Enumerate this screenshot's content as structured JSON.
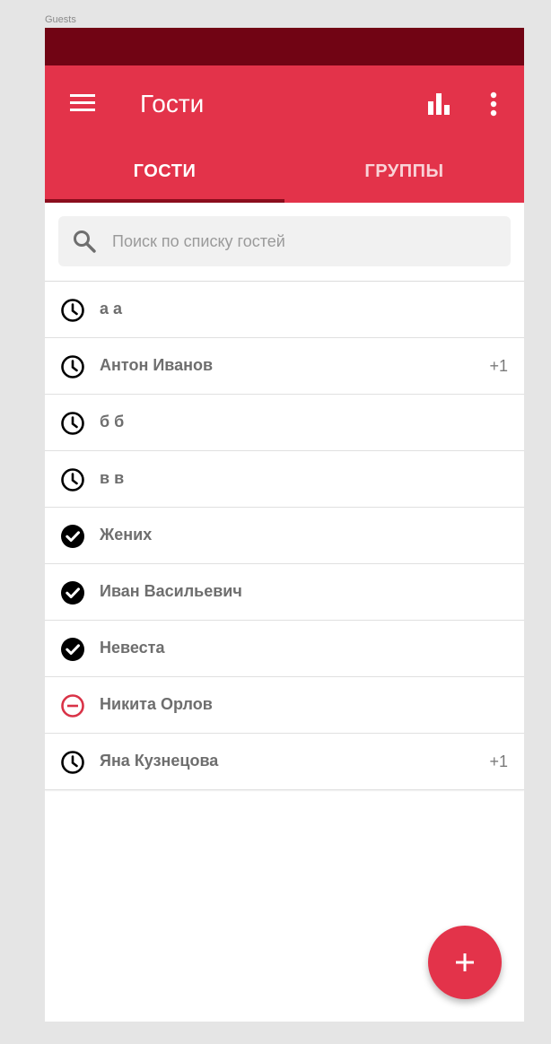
{
  "frame": {
    "label": "Guests"
  },
  "colors": {
    "status_bar": "#710414",
    "primary": "#e3334a",
    "tab_indicator": "#8b0d1d",
    "declined": "#d93347",
    "text": "#6e6e6e"
  },
  "app_bar": {
    "title": "Гости",
    "menu_icon": "hamburger-menu-icon",
    "stats_icon": "bar-chart-icon",
    "more_icon": "more-vert-icon"
  },
  "tabs": [
    {
      "label": "ГОСТИ",
      "active": true
    },
    {
      "label": "ГРУППЫ",
      "active": false
    }
  ],
  "search": {
    "placeholder": "Поиск по списку гостей",
    "value": "",
    "icon": "search-icon"
  },
  "guests": [
    {
      "name": "а а",
      "status": "pending",
      "plus": ""
    },
    {
      "name": "Антон Иванов",
      "status": "pending",
      "plus": "+1"
    },
    {
      "name": "б б",
      "status": "pending",
      "plus": ""
    },
    {
      "name": "в в",
      "status": "pending",
      "plus": ""
    },
    {
      "name": "Жених",
      "status": "confirmed",
      "plus": ""
    },
    {
      "name": "Иван Васильевич",
      "status": "confirmed",
      "plus": ""
    },
    {
      "name": "Невеста",
      "status": "confirmed",
      "plus": ""
    },
    {
      "name": "Никита Орлов",
      "status": "declined",
      "plus": ""
    },
    {
      "name": "Яна Кузнецова",
      "status": "pending",
      "plus": "+1"
    }
  ],
  "fab": {
    "icon": "add-icon"
  }
}
